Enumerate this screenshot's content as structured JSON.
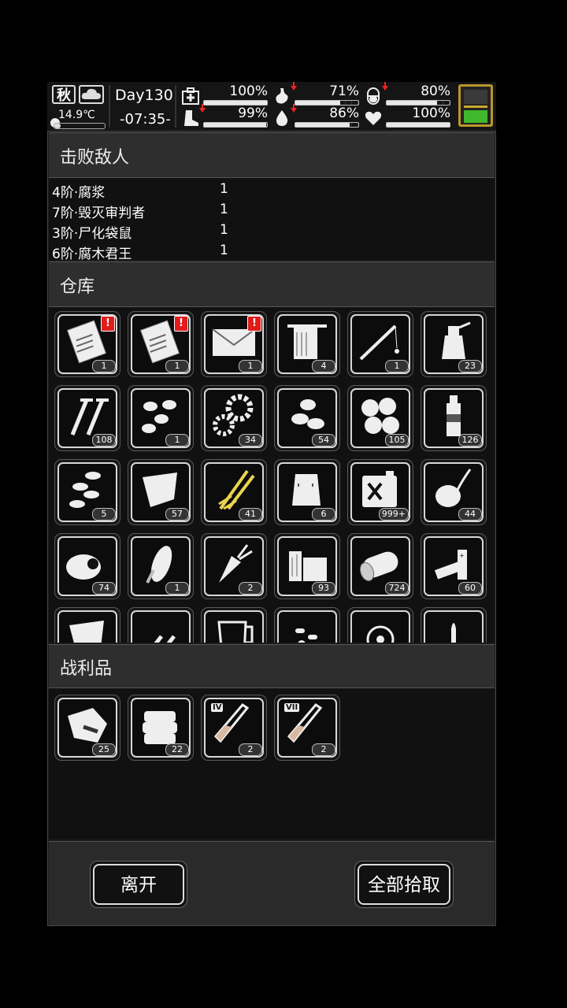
{
  "status": {
    "season": "秋",
    "weather_icon": "cloud-icon",
    "temperature": "14.9℃",
    "temperature_level": 0.12,
    "day": "Day130",
    "time": "-07:35-",
    "stats": [
      {
        "icon": "medkit-icon",
        "percent": "100%",
        "value": 1.0,
        "down": false
      },
      {
        "icon": "stomach-icon",
        "percent": "71%",
        "value": 0.71,
        "down": true
      },
      {
        "icon": "pill-icon",
        "percent": "80%",
        "value": 0.8,
        "down": true
      },
      {
        "icon": "boot-icon",
        "percent": "99%",
        "value": 0.99,
        "down": true
      },
      {
        "icon": "water-drop-icon",
        "percent": "86%",
        "value": 0.86,
        "down": true
      },
      {
        "icon": "heart-icon",
        "percent": "100%",
        "value": 1.0,
        "down": false
      }
    ]
  },
  "defeated": {
    "title": "击败敌人",
    "rows": [
      {
        "name": "4阶·腐浆",
        "count": "1"
      },
      {
        "name": "7阶·毁灭审判者",
        "count": "1"
      },
      {
        "name": "3阶·尸化袋鼠",
        "count": "1"
      },
      {
        "name": "6阶·腐木君王",
        "count": "1"
      }
    ]
  },
  "storage": {
    "title": "仓库",
    "items": [
      {
        "icon": "clipboard-icon",
        "count": "1",
        "alert": "!"
      },
      {
        "icon": "clipboard-icon",
        "count": "1",
        "alert": "!"
      },
      {
        "icon": "envelope-icon",
        "count": "1",
        "alert": "!"
      },
      {
        "icon": "towel-icon",
        "count": "4"
      },
      {
        "icon": "fishing-rod-icon",
        "count": "1"
      },
      {
        "icon": "spray-bottle-icon",
        "count": "23"
      },
      {
        "icon": "screws-icon",
        "count": "108"
      },
      {
        "icon": "seeds-icon",
        "count": "1"
      },
      {
        "icon": "gears-icon",
        "count": "34"
      },
      {
        "icon": "beans-icon",
        "count": "54"
      },
      {
        "icon": "nuts-icon",
        "count": "105"
      },
      {
        "icon": "bottle-icon",
        "count": "126"
      },
      {
        "icon": "sunflower-seeds-icon",
        "count": "5"
      },
      {
        "icon": "cloth-icon",
        "count": "57"
      },
      {
        "icon": "wheat-icon",
        "count": "41"
      },
      {
        "icon": "sack-icon",
        "count": "6"
      },
      {
        "icon": "fuel-can-icon",
        "count": "999+"
      },
      {
        "icon": "sprouting-potato-icon",
        "count": "44"
      },
      {
        "icon": "meat-icon",
        "count": "74"
      },
      {
        "icon": "corn-icon",
        "count": "1"
      },
      {
        "icon": "carrot-icon",
        "count": "2"
      },
      {
        "icon": "wood-planks-icon",
        "count": "93"
      },
      {
        "icon": "log-icon",
        "count": "724"
      },
      {
        "icon": "batteries-icon",
        "count": "60"
      },
      {
        "icon": "cloth-icon",
        "count": ""
      },
      {
        "icon": "bullets-icon",
        "count": ""
      },
      {
        "icon": "measuring-jug-icon",
        "count": ""
      },
      {
        "icon": "pills-icon",
        "count": ""
      },
      {
        "icon": "fan-icon",
        "count": ""
      },
      {
        "icon": "bullet-icon",
        "count": ""
      }
    ]
  },
  "loot": {
    "title": "战利品",
    "items": [
      {
        "icon": "raw-meat-icon",
        "count": "25"
      },
      {
        "icon": "fabric-stack-icon",
        "count": "22"
      },
      {
        "icon": "test-tube-icon",
        "count": "2",
        "tier": "IV"
      },
      {
        "icon": "test-tube-icon",
        "count": "2",
        "tier": "VII"
      }
    ]
  },
  "buttons": {
    "leave": "离开",
    "take_all": "全部拾取"
  }
}
